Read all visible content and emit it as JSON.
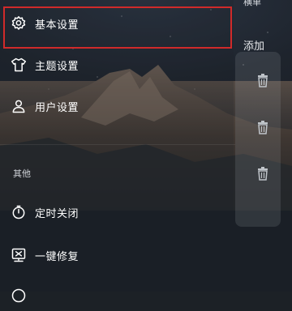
{
  "background": {
    "sky_color": "#1e242d",
    "mountain_color": "#4a413c"
  },
  "main": {
    "header_partial": "横单",
    "add_label": "添加"
  },
  "drawer": {
    "items_top": [
      {
        "name": "basic-settings",
        "label": "基本设置",
        "icon": "gear-icon",
        "selected": true
      },
      {
        "name": "theme-settings",
        "label": "主题设置",
        "icon": "shirt-icon"
      },
      {
        "name": "user-settings",
        "label": "用户设置",
        "icon": "user-icon"
      }
    ],
    "section_title": "其他",
    "items_other": [
      {
        "name": "timer-close",
        "label": "定时关闭",
        "icon": "timer-icon"
      },
      {
        "name": "one-click-repair",
        "label": "一键修复",
        "icon": "repair-icon"
      }
    ],
    "highlight_color": "#d02a2a"
  }
}
